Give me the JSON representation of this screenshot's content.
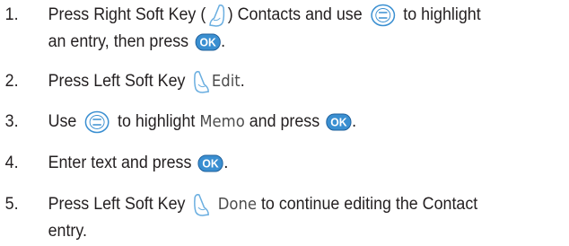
{
  "steps": [
    {
      "number": "1.",
      "line1_a": "Press Right Soft Key (",
      "line1_b": ") Contacts and use",
      "line1_c": "to highlight",
      "line2_a": "an entry, then press",
      "line2_b": "."
    },
    {
      "number": "2.",
      "text_a": "Press Left Soft Key",
      "ui_text": "Edit",
      "text_b": "."
    },
    {
      "number": "3.",
      "text_a": "Use",
      "text_b": "to highlight",
      "ui_text": "Memo",
      "text_c": "and press",
      "text_d": "."
    },
    {
      "number": "4.",
      "text_a": "Enter text and press",
      "text_b": "."
    },
    {
      "number": "5.",
      "line1_a": "Press Left Soft Key",
      "ui_text": "Done",
      "line1_b": "to continue editing the Contact",
      "line2": "entry."
    }
  ],
  "icons": {
    "ok_label": "OK",
    "ok_color": "#3a8fd1",
    "nav_color": "#3a8fd1",
    "softkey_color": "#6aaee0"
  }
}
